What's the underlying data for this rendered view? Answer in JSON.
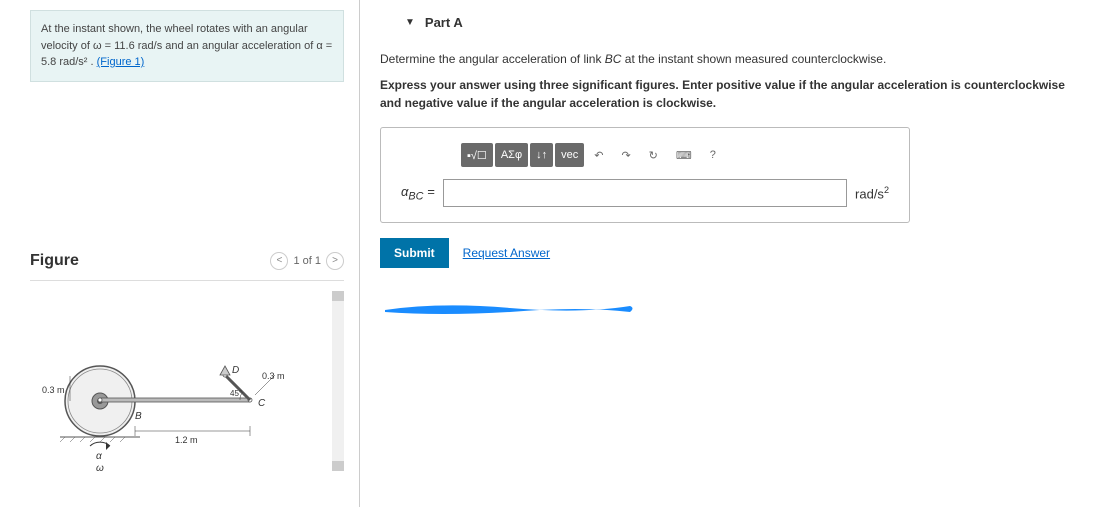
{
  "problem": {
    "text1": "At the instant shown, the wheel rotates with an angular velocity of ",
    "omega_eq": "ω = 11.6 rad/s",
    "text2": " and an angular acceleration of ",
    "alpha_eq": "α = 5.8 rad/s²",
    "text3": " . ",
    "figure_link": "(Figure 1)"
  },
  "figure": {
    "title": "Figure",
    "counter": "1 of 1",
    "labels": {
      "r_wheel": "0.3 m",
      "r_cd": "0.3 m",
      "L_bc": "1.2 m",
      "angle": "45°",
      "B": "B",
      "C": "C",
      "D": "D",
      "alpha": "α",
      "omega": "ω"
    }
  },
  "partA": {
    "title": "Part A",
    "instr1": "Determine the angular acceleration of link ",
    "instr1_var": "BC",
    "instr1_rest": " at the instant shown measured counterclockwise.",
    "instr2": "Express your answer using three significant figures. Enter positive value if the angular acceleration is counterclockwise and negative value if the angular acceleration is clockwise.",
    "var_label": "αBC =",
    "units_html": "rad/s²",
    "submit": "Submit",
    "request": "Request Answer",
    "tool_math": "ΑΣφ",
    "tool_vec": "vec",
    "tool_help": "?"
  }
}
